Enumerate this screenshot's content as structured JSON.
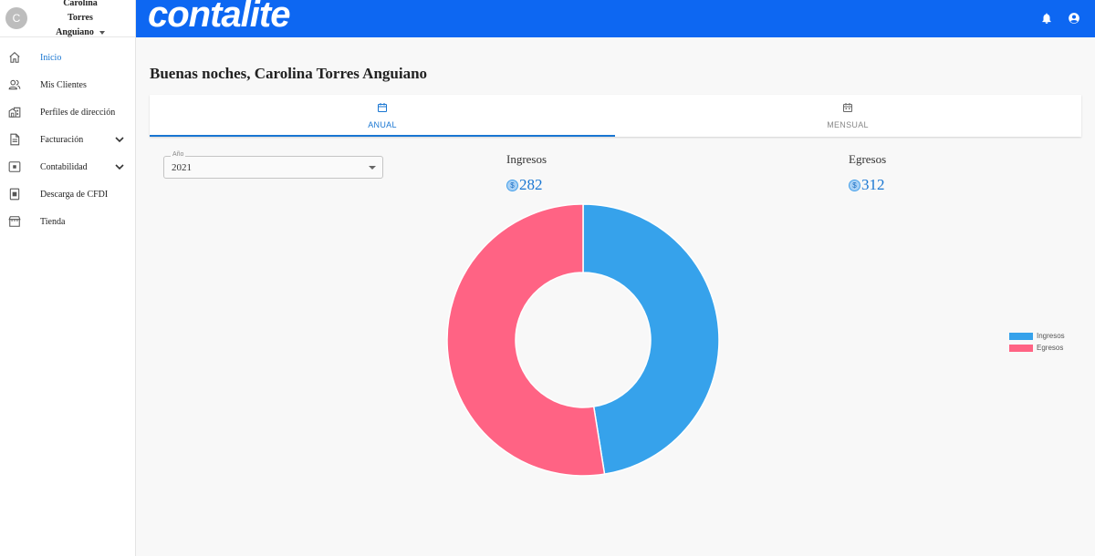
{
  "user": {
    "initial": "C",
    "name_line1": "Carolina Torres",
    "name_line2": "Anguiano"
  },
  "app": {
    "logo": "contalite",
    "brand_color": "#0d67f2"
  },
  "sidebar": {
    "items": [
      {
        "label": "Inicio",
        "icon": "home-icon",
        "active": true
      },
      {
        "label": "Mis Clientes",
        "icon": "people-icon"
      },
      {
        "label": "Perfiles de dirección",
        "icon": "building-icon"
      },
      {
        "label": "Facturación",
        "icon": "document-icon",
        "expandable": true
      },
      {
        "label": "Contabilidad",
        "icon": "ledger-icon",
        "expandable": true
      },
      {
        "label": "Descarga de CFDI",
        "icon": "download-file-icon"
      },
      {
        "label": "Tienda",
        "icon": "store-icon"
      }
    ]
  },
  "topbar": {
    "icons": [
      "bell-icon",
      "account-circle-icon"
    ]
  },
  "greeting": "Buenas noches, Carolina Torres Anguiano",
  "tabs": [
    {
      "label": "ANUAL",
      "icon": "calendar-icon",
      "active": true
    },
    {
      "label": "MENSUAL",
      "icon": "calendar-icon",
      "active": false
    }
  ],
  "year_select": {
    "label": "Año",
    "value": "2021"
  },
  "stats": {
    "ingresos": {
      "title": "Ingresos",
      "value": "282"
    },
    "egresos": {
      "title": "Egresos",
      "value": "312"
    }
  },
  "chart_data": {
    "type": "pie",
    "subtype": "doughnut",
    "categories": [
      "Ingresos",
      "Egresos"
    ],
    "values": [
      282,
      312
    ],
    "colors": [
      "#36a2eb",
      "#ff6384"
    ],
    "legend_position": "right"
  }
}
